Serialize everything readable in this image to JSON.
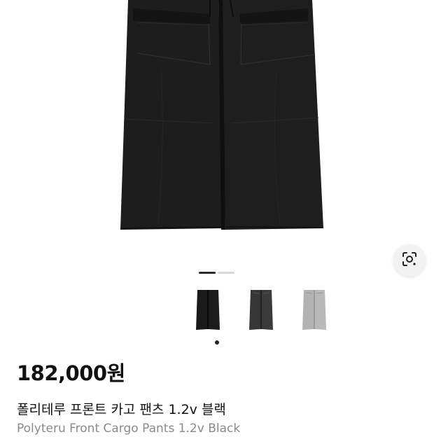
{
  "product": {
    "price": "182,000원",
    "name_ko": "폴리테루 프론트 카고 팬츠 1.2v 블랙",
    "name_en": "Polyteru Front Cargo Pants 1.2v Black"
  },
  "gallery": {
    "total_images": 2,
    "current_index": 1
  },
  "color_options": [
    {
      "name": "black",
      "color": "#1f1f1f",
      "selected": true
    },
    {
      "name": "charcoal",
      "color": "#3a3a3a",
      "selected": false
    },
    {
      "name": "light-gray",
      "color": "#b5b5b5",
      "selected": false
    }
  ],
  "icons": {
    "lens": "image-search-icon"
  },
  "colors": {
    "pants": "#1d1d1d",
    "price_text": "#111111",
    "subtitle_text": "#8a8a8a"
  }
}
